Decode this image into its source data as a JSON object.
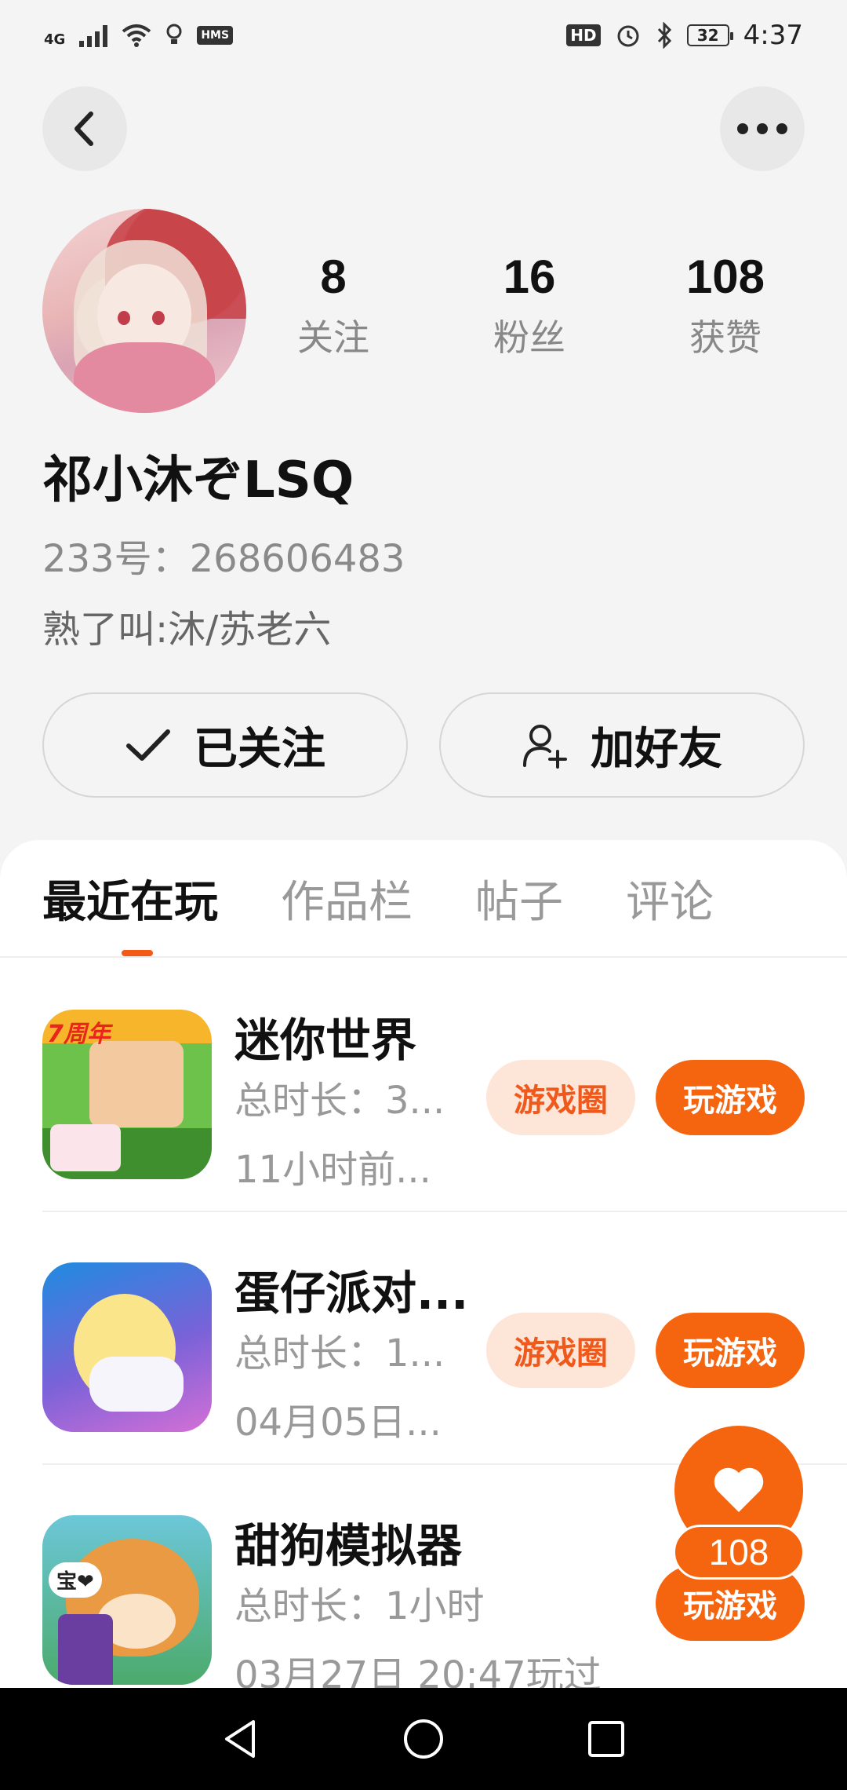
{
  "status_bar": {
    "network": "4G",
    "hms_badge": "HMS",
    "hd_badge": "HD",
    "battery": "32",
    "time": "4:37"
  },
  "profile": {
    "username": "祁小沐ぞLSQ",
    "account_id": "233号：268606483",
    "bio": "熟了叫:沐/苏老六",
    "stats": [
      {
        "value": "8",
        "label": "关注"
      },
      {
        "value": "16",
        "label": "粉丝"
      },
      {
        "value": "108",
        "label": "获赞"
      }
    ],
    "follow_button": "已关注",
    "add_friend_button": "加好友"
  },
  "tabs": [
    {
      "label": "最近在玩",
      "active": true
    },
    {
      "label": "作品栏",
      "active": false
    },
    {
      "label": "帖子",
      "active": false
    },
    {
      "label": "评论",
      "active": false
    }
  ],
  "games": [
    {
      "title": "迷你世界",
      "total_time": "总时长：3...",
      "last_played": "11小时前...",
      "circle_label": "游戏圈",
      "play_label": "玩游戏",
      "icon_badge": "7周年"
    },
    {
      "title": "蛋仔派对...",
      "total_time": "总时长：1...",
      "last_played": "04月05日...",
      "circle_label": "游戏圈",
      "play_label": "玩游戏"
    },
    {
      "title": "甜狗模拟器",
      "total_time": "总时长：1小时",
      "last_played": "03月27日 20:47玩过",
      "play_label": "玩游戏",
      "icon_tag": "宝❤"
    }
  ],
  "like": {
    "count": "108"
  },
  "colors": {
    "accent": "#f5640f",
    "chip_bg": "#fde5d8",
    "chip_text": "#ef5a1c"
  }
}
